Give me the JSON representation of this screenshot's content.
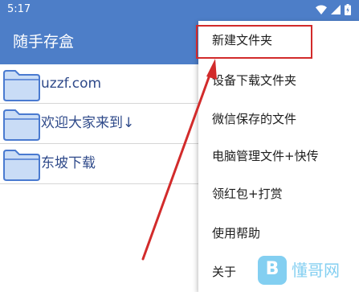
{
  "status_bar": {
    "time": "5:17",
    "icons": [
      "wifi-icon",
      "signal-icon",
      "battery-icon"
    ]
  },
  "app_bar": {
    "title": "随手存盒",
    "color": "#4d7ec8"
  },
  "folders": [
    {
      "name": "uzzf.com",
      "icon": "folder-icon"
    },
    {
      "name": "欢迎大家来到↓",
      "icon": "folder-icon"
    },
    {
      "name": "东坡下载",
      "icon": "folder-icon"
    }
  ],
  "menu": {
    "items": [
      {
        "label": "新建文件夹",
        "highlighted": true
      },
      {
        "label": "设备下载文件夹"
      },
      {
        "label": "微信保存的文件"
      },
      {
        "label": "电脑管理文件+快传"
      },
      {
        "label": "领红包+打赏"
      },
      {
        "label": "使用帮助"
      },
      {
        "label": "关于"
      }
    ]
  },
  "annotation": {
    "color": "#d22b2b"
  },
  "watermark": {
    "badge": "B",
    "text": "懂哥网"
  }
}
